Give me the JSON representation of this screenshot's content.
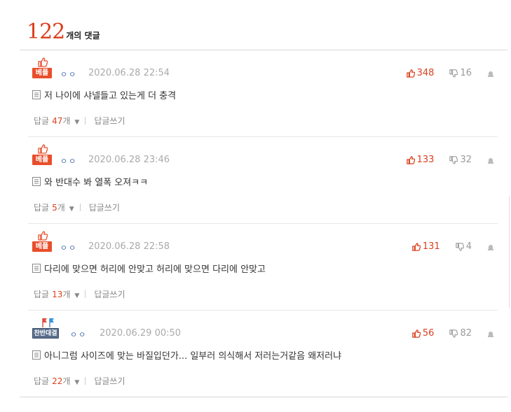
{
  "header": {
    "count": "122",
    "suffix": "개의 댓글"
  },
  "comments": [
    {
      "badge": "베플",
      "badge_type": "best",
      "author": "ㅇㅇ",
      "date": "2020.06.28 22:54",
      "up": "348",
      "down": "16",
      "text": "저 나이에 샤넬들고 있는게 더 충격",
      "reply_label": "답글",
      "reply_count": "47",
      "reply_unit": "개",
      "write_reply": "답글쓰기"
    },
    {
      "badge": "베플",
      "badge_type": "best",
      "author": "ㅇㅇ",
      "date": "2020.06.28 23:46",
      "up": "133",
      "down": "32",
      "text": "와 반대수 봐 열폭 오져ㅋㅋ",
      "reply_label": "답글",
      "reply_count": "5",
      "reply_unit": "개",
      "write_reply": "답글쓰기"
    },
    {
      "badge": "베플",
      "badge_type": "best",
      "author": "ㅇㅇ",
      "date": "2020.06.28 22:58",
      "up": "131",
      "down": "4",
      "text": "다리에 맞으면 허리에 안맞고 허리에 맞으면 다리에 안맞고",
      "reply_label": "답글",
      "reply_count": "13",
      "reply_unit": "개",
      "write_reply": "답글쓰기"
    },
    {
      "badge": "찬반대결",
      "badge_type": "debate",
      "author": "ㅇㅇ",
      "date": "2020.06.29 00:50",
      "up": "56",
      "down": "82",
      "text": "아니그럼 사이즈에 맞는 바질입던가... 일부러 의식해서 저러는거같음 왜저러냐",
      "reply_label": "답글",
      "reply_count": "22",
      "reply_unit": "개",
      "write_reply": "답글쓰기"
    }
  ],
  "colors": {
    "accent": "#d9401f",
    "badge_best": "#e94e2b",
    "badge_debate": "#5a6f8e",
    "author": "#4a6fb0"
  },
  "icons": {
    "best": "thumbs-up-icon",
    "debate": "flags-icon",
    "up": "thumbs-up-icon",
    "down": "thumbs-down-icon",
    "report": "siren-icon",
    "content": "document-icon",
    "caret": "caret-down-icon"
  }
}
